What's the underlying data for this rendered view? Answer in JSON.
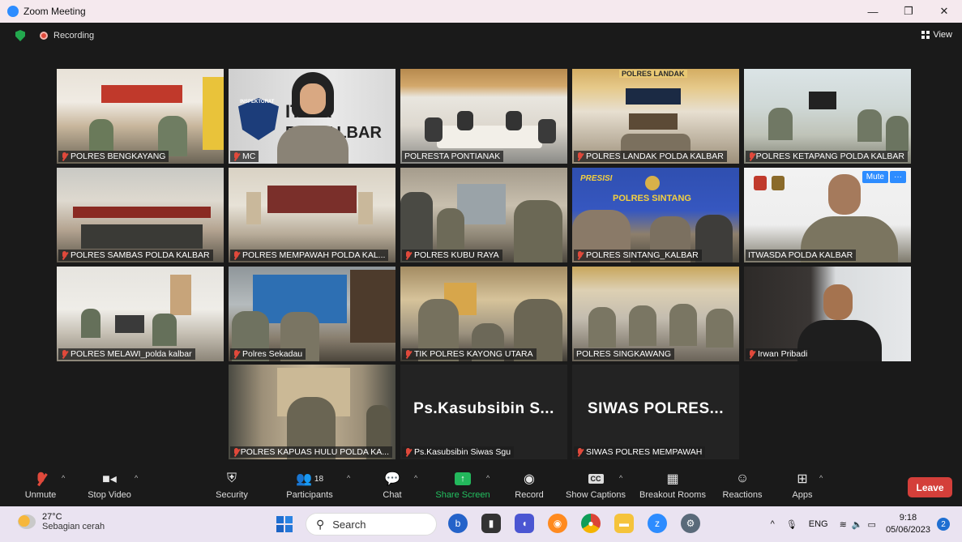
{
  "window": {
    "title": "Zoom Meeting",
    "minimize": "—",
    "restore": "❐",
    "close": "✕"
  },
  "topbar": {
    "recording_label": "Recording",
    "view_label": "View"
  },
  "participants": [
    {
      "name": "POLRES BENGKAYANG",
      "muted": true
    },
    {
      "name": "MC",
      "muted": true
    },
    {
      "name": "POLRESTA PONTIANAK",
      "muted": false
    },
    {
      "name": "POLRES LANDAK POLDA KALBAR",
      "muted": true
    },
    {
      "name": "POLRES KETAPANG POLDA KALBAR",
      "muted": true
    },
    {
      "name": "POLRES SAMBAS POLDA KALBAR",
      "muted": true
    },
    {
      "name": "POLRES MEMPAWAH POLDA KAL...",
      "muted": true
    },
    {
      "name": "POLRES KUBU RAYA",
      "muted": true
    },
    {
      "name": "POLRES SINTANG_KALBAR",
      "muted": true
    },
    {
      "name": "ITWASDA POLDA KALBAR",
      "muted": false,
      "active": true
    },
    {
      "name": "POLRES MELAWI_polda kalbar",
      "muted": true
    },
    {
      "name": "Polres Sekadau",
      "muted": true
    },
    {
      "name": "TIK POLRES KAYONG UTARA",
      "muted": true
    },
    {
      "name": "POLRES SINGKAWANG",
      "muted": false
    },
    {
      "name": "Irwan Pribadi",
      "muted": true
    },
    {
      "name": "POLRES KAPUAS HULU POLDA KA...",
      "muted": true
    },
    {
      "name": "Ps.Kasubsibin Siwas Sgu",
      "muted": true,
      "video_off": true,
      "display": "Ps.Kasubsibin  S..."
    },
    {
      "name": "SIWAS POLRES MEMPAWAH",
      "muted": true,
      "video_off": true,
      "display": "SIWAS  POLRES..."
    }
  ],
  "active_popover": {
    "mute": "Mute",
    "more": "···"
  },
  "tile_texts": {
    "lpr_banner": "POLRES LANDAK",
    "sintang_banner": "POLRES SINTANG",
    "presisi": "PRESISI",
    "inspektorat": "INSPEKTORAT",
    "mc_wall": "IT  DA",
    "mc_wall2": "PO  KALBAR"
  },
  "toolbar": {
    "unmute": "Unmute",
    "stop_video": "Stop Video",
    "security": "Security",
    "participants": "Participants",
    "participants_count": "18",
    "chat": "Chat",
    "share_screen": "Share Screen",
    "record": "Record",
    "show_captions": "Show Captions",
    "breakout_rooms": "Breakout Rooms",
    "reactions": "Reactions",
    "apps": "Apps",
    "leave": "Leave"
  },
  "taskbar": {
    "temperature": "27°C",
    "weather": "Sebagian cerah",
    "search_placeholder": "Search",
    "language": "ENG",
    "time": "9:18",
    "date": "05/06/2023",
    "notifications": "2"
  },
  "colors": {
    "accent": "#2d8cff",
    "leave": "#d43f3a",
    "share": "#23b85c",
    "active_border": "#e4eb4a",
    "muted": "#e0493b"
  }
}
